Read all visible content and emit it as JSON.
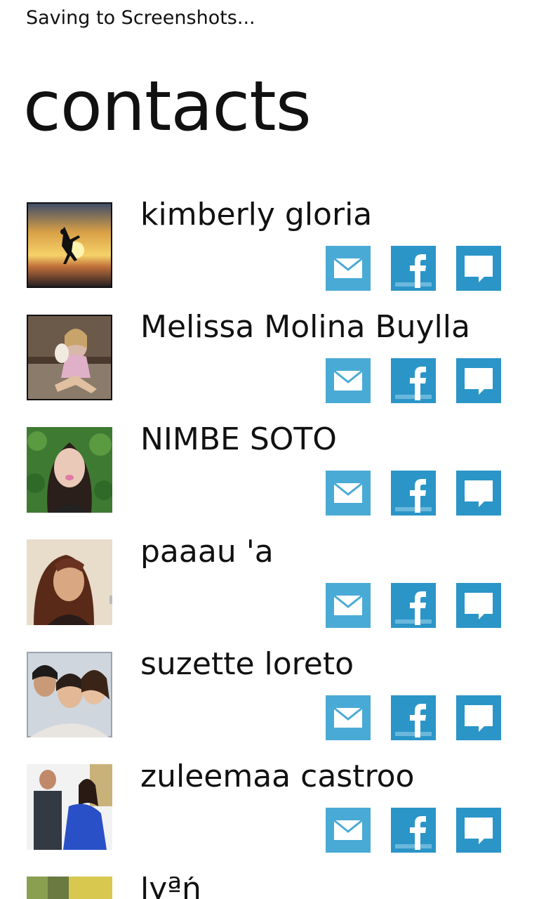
{
  "status_bar": {
    "text": "Saving to Screenshots..."
  },
  "page": {
    "title": "contacts"
  },
  "colors": {
    "mail_tile": "#4aaad6",
    "facebook_tile": "#2b95c7",
    "message_tile": "#2b95c7",
    "text": "#111111",
    "background": "#ffffff"
  },
  "contacts": [
    {
      "name": "kimberly gloria",
      "avatar": "sunset-silhouette-photo"
    },
    {
      "name": "Melissa Molina Buylla",
      "avatar": "woman-with-dog-photo"
    },
    {
      "name": "NIMBE SOTO",
      "avatar": "woman-portrait-leaves-photo"
    },
    {
      "name": "paaau 'a",
      "avatar": "woman-curly-hair-photo"
    },
    {
      "name": "suzette loreto",
      "avatar": "three-friends-selfie-photo"
    },
    {
      "name": "zuleemaa castroo",
      "avatar": "couple-blue-dress-photo"
    },
    {
      "name": "lyªń",
      "avatar": "partial-photo"
    }
  ],
  "actions": {
    "mail": "mail-icon",
    "facebook": "facebook-icon",
    "message": "message-icon"
  }
}
